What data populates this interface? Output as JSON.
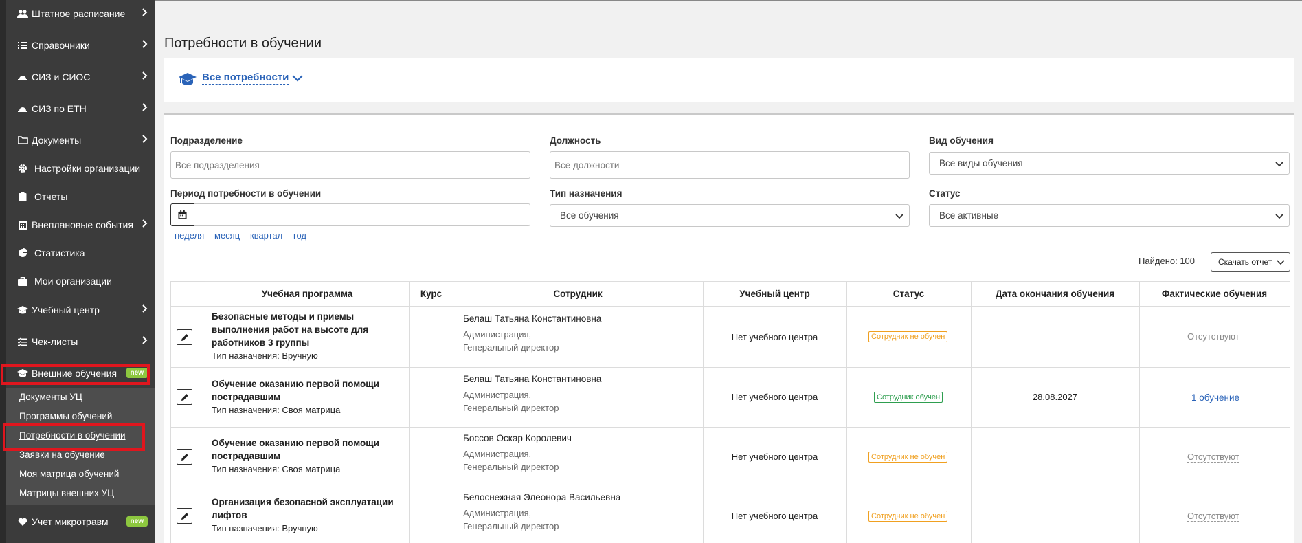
{
  "sidebar": {
    "items": [
      {
        "label": "Штатное расписание",
        "icon": "users-icon"
      },
      {
        "label": "Справочники",
        "icon": "list-icon"
      },
      {
        "label": "СИЗ и СИОС",
        "icon": "helmet-icon"
      },
      {
        "label": "СИЗ по ЕТН",
        "icon": "helmet-icon"
      },
      {
        "label": "Документы",
        "icon": "folder-icon"
      },
      {
        "label": "Настройки организации",
        "icon": "gear-icon"
      },
      {
        "label": "Отчеты",
        "icon": "clipboard-icon"
      },
      {
        "label": "Внеплановые события",
        "icon": "calendar-icon"
      },
      {
        "label": "Статистика",
        "icon": "pie-chart-icon"
      },
      {
        "label": "Мои организации",
        "icon": "briefcase-icon"
      },
      {
        "label": "Учебный центр",
        "icon": "graduation-cap-icon"
      },
      {
        "label": "Чек-листы",
        "icon": "checklist-icon"
      },
      {
        "label": "Внешние обучения",
        "icon": "graduation-cap-icon",
        "badge": "new"
      },
      {
        "label": "Учет микротравм",
        "icon": "heart-icon",
        "badge": "new"
      }
    ],
    "submenu": [
      "Документы УЦ",
      "Программы обучений",
      "Потребности в обучении",
      "Заявки на обучение",
      "Моя матрица обучений",
      "Матрицы внешних УЦ"
    ]
  },
  "page": {
    "title": "Потребности в обучении",
    "needs_filter": "Все потребности"
  },
  "filters": {
    "division_label": "Подразделение",
    "division_placeholder": "Все подразделения",
    "position_label": "Должность",
    "position_placeholder": "Все должности",
    "training_type_label": "Вид обучения",
    "training_type_value": "Все виды обучения",
    "period_label": "Период потребности в обучении",
    "assign_type_label": "Тип назначения",
    "assign_type_value": "Все обучения",
    "status_label": "Статус",
    "status_value": "Все активные",
    "quick_periods": [
      "неделя",
      "месяц",
      "квартал",
      "год"
    ]
  },
  "results": {
    "found": "Найдено: 100",
    "download": "Скачать отчет"
  },
  "table": {
    "headers": [
      "Учебная программа",
      "Курс",
      "Сотрудник",
      "Учебный центр",
      "Статус",
      "Дата окончания обучения",
      "Фактические обучения"
    ],
    "rows": [
      {
        "program_lines": [
          "Безопасные методы и приемы",
          "выполнения работ на высоте для",
          "работников 3 группы"
        ],
        "assign": "Тип назначения: Вручную",
        "employee": "Белаш Татьяна Константиновна",
        "dept": "Администрация,",
        "position": "Генеральный директор",
        "center": "Нет учебного центра",
        "status": "Сотрудник не обучен",
        "status_kind": "bad",
        "end_date": "",
        "fact": "Отсутствуют"
      },
      {
        "program_lines": [
          "Обучение оказанию первой помощи",
          "пострадавшим"
        ],
        "assign": "Тип назначения: Своя матрица",
        "employee": "Белаш Татьяна Константиновна",
        "dept": "Администрация,",
        "position": "Генеральный директор",
        "center": "Нет учебного центра",
        "status": "Сотрудник обучен",
        "status_kind": "good",
        "end_date": "28.08.2027",
        "fact": "1 обучение"
      },
      {
        "program_lines": [
          "Обучение оказанию первой помощи",
          "пострадавшим"
        ],
        "assign": "Тип назначения: Своя матрица",
        "employee": "Боссов Оскар Королевич",
        "dept": "Администрация,",
        "position": "Генеральный директор",
        "center": "Нет учебного центра",
        "status": "Сотрудник не обучен",
        "status_kind": "bad",
        "end_date": "",
        "fact": "Отсутствуют"
      },
      {
        "program_lines": [
          "Организация безопасной эксплуатации",
          "лифтов"
        ],
        "assign": "Тип назначения: Вручную",
        "employee": "Белоснежная Элеонора Васильевна",
        "dept": "Администрация,",
        "position": "Генеральный директор",
        "center": "Нет учебного центра",
        "status": "Сотрудник не обучен",
        "status_kind": "bad",
        "end_date": "",
        "fact": "Отсутствуют"
      }
    ]
  },
  "colors": {
    "sidebar_bg": "#3b3b3b",
    "accent_link": "#2a63b8",
    "badge_new": "#8dc73f",
    "highlight": "#e0161e",
    "status_bad": "#f0a020",
    "status_good": "#2e9e4f"
  }
}
